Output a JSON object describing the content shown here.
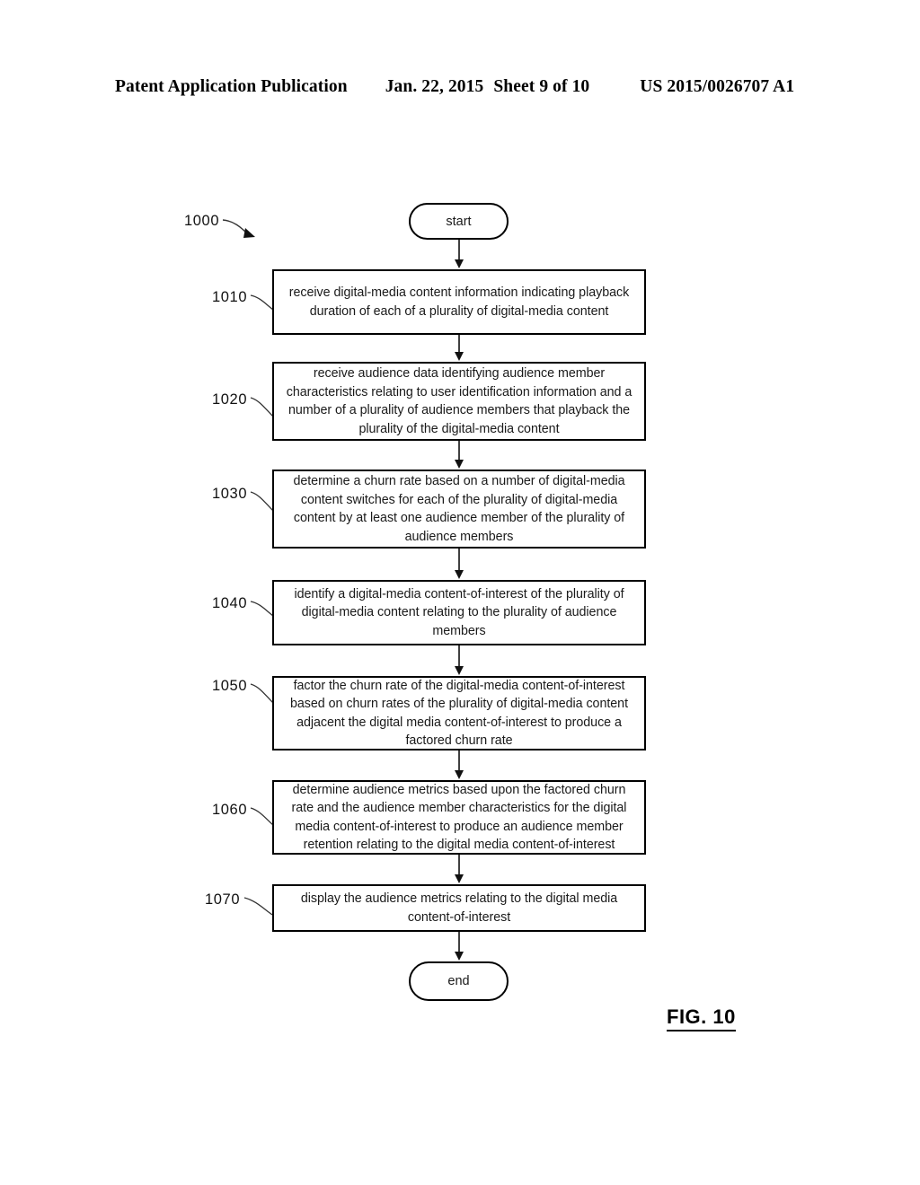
{
  "header": {
    "publication": "Patent Application Publication",
    "date": "Jan. 22, 2015",
    "sheet": "Sheet 9 of 10",
    "patent_number": "US 2015/0026707 A1"
  },
  "figure": {
    "label": "FIG. 10",
    "diagram_reference": "1000"
  },
  "flowchart": {
    "start_label": "start",
    "end_label": "end",
    "steps": [
      {
        "ref": "1010",
        "text": "receive digital-media content information indicating playback duration of each of a plurality of digital-media content"
      },
      {
        "ref": "1020",
        "text": "receive audience data identifying audience member characteristics relating to user identification information and a number of a plurality of audience members that playback the plurality of the digital-media content"
      },
      {
        "ref": "1030",
        "text": "determine a churn rate based on a number of digital-media content switches for each of the plurality of digital-media content by at least one audience member of the plurality of audience members"
      },
      {
        "ref": "1040",
        "text": "identify a digital-media content-of-interest of the plurality of digital-media content relating to the plurality of audience members"
      },
      {
        "ref": "1050",
        "text": "factor the churn rate of the digital-media content-of-interest based on churn rates of the plurality of digital-media content adjacent the digital media content-of-interest to produce a factored churn rate"
      },
      {
        "ref": "1060",
        "text": "determine audience metrics based upon the factored churn rate and the audience member characteristics for the digital media content-of-interest to produce an audience member retention relating to the digital media content-of-interest"
      },
      {
        "ref": "1070",
        "text": "display the audience metrics relating to the digital media content-of-interest"
      }
    ]
  }
}
